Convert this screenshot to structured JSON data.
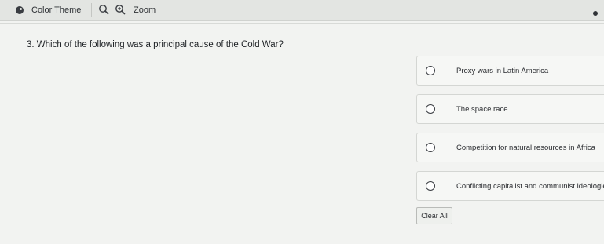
{
  "toolbar": {
    "color_theme_label": "Color Theme",
    "zoom_label": "Zoom"
  },
  "question": {
    "number": "3.",
    "text": "Which of the following was a principal cause of the Cold War?"
  },
  "options": [
    {
      "label": "Proxy wars in Latin America",
      "selected": false
    },
    {
      "label": "The space race",
      "selected": false
    },
    {
      "label": "Competition for natural resources in Africa",
      "selected": false
    },
    {
      "label": "Conflicting capitalist and communist ideologies",
      "selected": false
    }
  ],
  "actions": {
    "clear_label": "Clear All"
  },
  "icons": {
    "palette": "palette-icon",
    "zoom_out": "zoom-out-icon",
    "zoom_in": "zoom-in-icon"
  }
}
